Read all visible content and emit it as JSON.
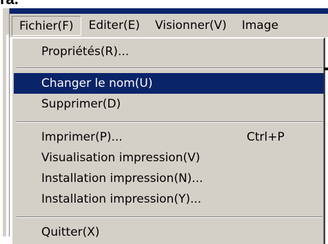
{
  "caption": "ra.",
  "menubar": {
    "items": [
      {
        "label": "Fichier(F)",
        "name": "menubar-fichier"
      },
      {
        "label": "Editer(E)",
        "name": "menubar-editer"
      },
      {
        "label": "Visionner(V)",
        "name": "menubar-visionner"
      },
      {
        "label": "Image",
        "name": "menubar-image"
      }
    ]
  },
  "menu": {
    "properties": "Propriétés(R)...",
    "rename": "Changer le nom(U)",
    "delete": "Supprimer(D)",
    "print": "Imprimer(P)...",
    "print_shortcut": "Ctrl+P",
    "print_preview": "Visualisation impression(V)",
    "print_setup_n": "Installation impression(N)...",
    "print_setup_y": "Installation impression(Y)...",
    "quit": "Quitter(X)"
  },
  "colors": {
    "highlight": "#0a246a",
    "menu_bg": "#d4d0c8"
  }
}
